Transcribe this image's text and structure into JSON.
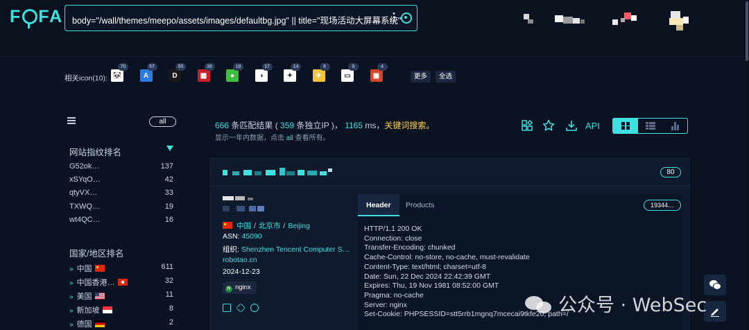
{
  "app": {
    "logo": "FOFA",
    "search_query": "body=\"/wall/themes/meepo/assets/images/defaultbg.jpg\" || title=\"现场活动大屏幕系统\""
  },
  "icon_row": {
    "label": "相关icon(10):",
    "icons": [
      {
        "name": "panda-icon",
        "count": "70",
        "bg": "#ffffff",
        "glyph": "🐼"
      },
      {
        "name": "app-store-icon",
        "count": "57",
        "bg": "#2b7de0",
        "glyph": "A"
      },
      {
        "name": "d-brand-icon",
        "count": "55",
        "bg": "#1a1a1a",
        "glyph": "D"
      },
      {
        "name": "red-grid-icon",
        "count": "39",
        "bg": "#c8202b",
        "glyph": "▦"
      },
      {
        "name": "wechat-green-icon",
        "count": "19",
        "bg": "#3fbf3f",
        "glyph": "●"
      },
      {
        "name": "ball-icon",
        "count": "17",
        "bg": "#ffffff",
        "glyph": "◑"
      },
      {
        "name": "rocket-icon",
        "count": "14",
        "bg": "#ffffff",
        "glyph": "✦"
      },
      {
        "name": "runner-icon",
        "count": "5",
        "bg": "#f3c33c",
        "glyph": "✈"
      },
      {
        "name": "document-icon",
        "count": "5",
        "bg": "#ffffff",
        "glyph": "▭"
      },
      {
        "name": "red-seal-icon",
        "count": "4",
        "bg": "#d4452b",
        "glyph": "▣"
      }
    ],
    "more_label": "更多",
    "select_all_label": "全选"
  },
  "sidebar": {
    "all_label": "all",
    "fingerprint_title": "网站指纹排名",
    "fingerprints": [
      {
        "label": "G52ok…",
        "count": "137"
      },
      {
        "label": "xSYqO…",
        "count": "42"
      },
      {
        "label": "qtyVX…",
        "count": "33"
      },
      {
        "label": "TXWQ…",
        "count": "19"
      },
      {
        "label": "wt4QC…",
        "count": "16"
      }
    ],
    "country_title": "国家/地区排名",
    "countries": [
      {
        "label": "中国",
        "count": "611",
        "flag": "cn"
      },
      {
        "label": "中国香港…",
        "count": "32",
        "flag": "hk"
      },
      {
        "label": "美国",
        "count": "11",
        "flag": "us"
      },
      {
        "label": "新加坡",
        "count": "8",
        "flag": "sg"
      },
      {
        "label": "德国",
        "count": "2",
        "flag": "de"
      }
    ]
  },
  "results": {
    "total": "666",
    "total_text": " 条匹配结果 (",
    "unique_ip": "359",
    "unique_ip_text": " 条独立IP )，",
    "time_ms": "1165",
    "ms_text": " ms，",
    "keyword_search": "关键词搜索。",
    "note_before": "显示一年内数据，点击 ",
    "note_link": "all",
    "note_after": " 查看所有。",
    "api_label": "API"
  },
  "card": {
    "port": "80",
    "country": "中国",
    "city": "北京市",
    "city_en": "Beijing",
    "asn_label": "ASN:",
    "asn": "45090",
    "org_label": "组织:",
    "org": "Shenzhen Tencent Computer S…",
    "domain": "robotao.cn",
    "date": "2024-12-23",
    "tag": "nginx",
    "tag_icon": "N",
    "tab_header": "Header",
    "tab_products": "Products",
    "hash": "19344…",
    "header_text": "HTTP/1.1 200 OK\nConnection: close\nTransfer-Encoding: chunked\nCache-Control: no-store, no-cache, must-revalidate\nContent-Type: text/html; charset=utf-8\nDate: Sun, 22 Dec 2024 22:42:39 GMT\nExpires: Thu, 19 Nov 1981 08:52:00 GMT\nPragma: no-cache\nServer: nginx\nSet-Cookie: PHPSESSID=stt5rrb1mgnq7mcecai9tkfe20; path=/"
  },
  "watermark": "公众号 · WebSec"
}
